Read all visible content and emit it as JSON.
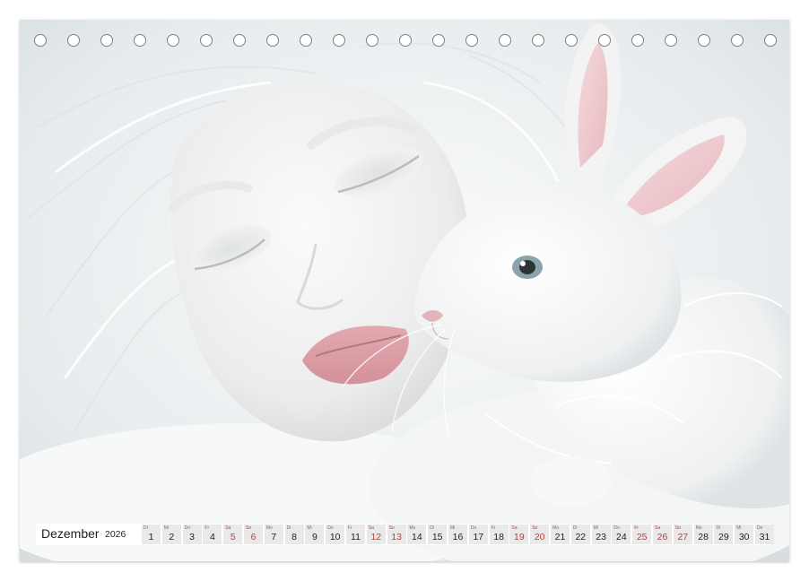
{
  "calendar": {
    "month": "Dezember",
    "year": "2026",
    "days": [
      {
        "dow": "Di",
        "num": "1",
        "weekend": false
      },
      {
        "dow": "Mi",
        "num": "2",
        "weekend": false
      },
      {
        "dow": "Do",
        "num": "3",
        "weekend": false
      },
      {
        "dow": "Fr",
        "num": "4",
        "weekend": false
      },
      {
        "dow": "Sa",
        "num": "5",
        "weekend": true
      },
      {
        "dow": "So",
        "num": "6",
        "weekend": true
      },
      {
        "dow": "Mo",
        "num": "7",
        "weekend": false
      },
      {
        "dow": "Di",
        "num": "8",
        "weekend": false
      },
      {
        "dow": "Mi",
        "num": "9",
        "weekend": false
      },
      {
        "dow": "Do",
        "num": "10",
        "weekend": false
      },
      {
        "dow": "Fr",
        "num": "11",
        "weekend": false
      },
      {
        "dow": "Sa",
        "num": "12",
        "weekend": true
      },
      {
        "dow": "So",
        "num": "13",
        "weekend": true
      },
      {
        "dow": "Mo",
        "num": "14",
        "weekend": false
      },
      {
        "dow": "Di",
        "num": "15",
        "weekend": false
      },
      {
        "dow": "Mi",
        "num": "16",
        "weekend": false
      },
      {
        "dow": "Do",
        "num": "17",
        "weekend": false
      },
      {
        "dow": "Fr",
        "num": "18",
        "weekend": false
      },
      {
        "dow": "Sa",
        "num": "19",
        "weekend": true
      },
      {
        "dow": "So",
        "num": "20",
        "weekend": true
      },
      {
        "dow": "Mo",
        "num": "21",
        "weekend": false
      },
      {
        "dow": "Di",
        "num": "22",
        "weekend": false
      },
      {
        "dow": "Mi",
        "num": "23",
        "weekend": false
      },
      {
        "dow": "Do",
        "num": "24",
        "weekend": false
      },
      {
        "dow": "Fr",
        "num": "25",
        "weekend": true
      },
      {
        "dow": "Sa",
        "num": "26",
        "weekend": true
      },
      {
        "dow": "So",
        "num": "27",
        "weekend": true
      },
      {
        "dow": "Mo",
        "num": "28",
        "weekend": false
      },
      {
        "dow": "Di",
        "num": "29",
        "weekend": false
      },
      {
        "dow": "Mi",
        "num": "30",
        "weekend": false
      },
      {
        "dow": "Do",
        "num": "31",
        "weekend": false
      }
    ]
  },
  "binding_holes": 23,
  "colors": {
    "weekend": "#c23a3a",
    "paper": "#f3f5f6",
    "lips": "#d99aa2",
    "ear_inner": "#eec7cc",
    "eye": "#8aa3ad"
  }
}
